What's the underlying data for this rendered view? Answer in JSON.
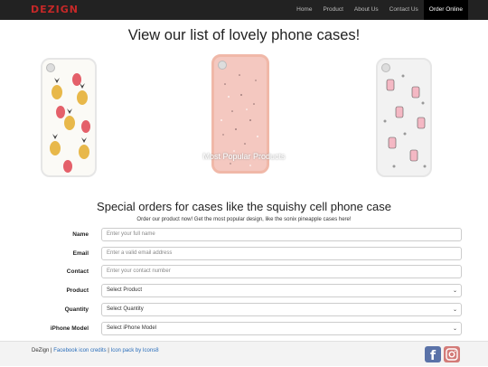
{
  "nav": {
    "brand": "DEZIGN",
    "items": [
      {
        "label": "Home"
      },
      {
        "label": "Product"
      },
      {
        "label": "About Us"
      },
      {
        "label": "Contact Us"
      },
      {
        "label": "Order Online",
        "active": true
      }
    ]
  },
  "hero": {
    "title": "View our list of lovely phone cases!",
    "caption": "Most Popular Products"
  },
  "order": {
    "title": "Special orders for cases like the squishy cell phone case",
    "subtitle": "Order our product now! Get the most popular design, like the sonix pineapple cases here!",
    "fields": [
      {
        "label": "Name",
        "placeholder": "Enter your full name"
      },
      {
        "label": "Email",
        "placeholder": "Enter a valid email address"
      },
      {
        "label": "Contact",
        "placeholder": "Enter your contact number"
      },
      {
        "label": "Product",
        "selected": "Select Product"
      },
      {
        "label": "Quantity",
        "selected": "Select Quantity"
      },
      {
        "label": "iPhone Model",
        "selected": "Select iPhone Model"
      }
    ]
  },
  "footer": {
    "brand": "DeZign",
    "sep": "|",
    "credit1": "Facebook icon credits",
    "credit2": "Icon pack by Icons8"
  },
  "colors": {
    "navbar": "#222222",
    "brand": "#c62828",
    "link": "#2a6ebb"
  }
}
